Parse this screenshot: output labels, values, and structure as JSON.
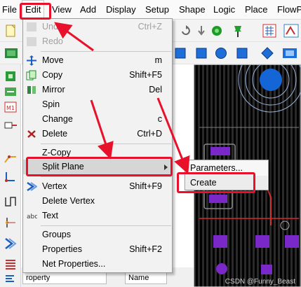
{
  "menubar": {
    "items": [
      "File",
      "Edit",
      "View",
      "Add",
      "Display",
      "Setup",
      "Shape",
      "Logic",
      "Place",
      "FlowPl"
    ]
  },
  "edit_menu": {
    "items": [
      {
        "label": "Undo",
        "shortcut": "Ctrl+Z",
        "enabled": false,
        "icon": "undo-icon"
      },
      {
        "label": "Redo",
        "shortcut": "",
        "enabled": false,
        "icon": "redo-icon"
      },
      {
        "label": "Move",
        "shortcut": "m",
        "enabled": true,
        "icon": "move-icon"
      },
      {
        "label": "Copy",
        "shortcut": "Shift+F5",
        "enabled": true,
        "icon": "copy-icon"
      },
      {
        "label": "Mirror",
        "shortcut": "Del",
        "enabled": true,
        "icon": "mirror-icon"
      },
      {
        "label": "Spin",
        "shortcut": "",
        "enabled": true,
        "icon": ""
      },
      {
        "label": "Change",
        "shortcut": "c",
        "enabled": true,
        "icon": ""
      },
      {
        "label": "Delete",
        "shortcut": "Ctrl+D",
        "enabled": true,
        "icon": "delete-icon"
      },
      {
        "label": "Z-Copy",
        "shortcut": "",
        "enabled": true,
        "icon": ""
      },
      {
        "label": "Split Plane",
        "shortcut": "",
        "enabled": true,
        "icon": "",
        "submenu": true
      },
      {
        "label": "Vertex",
        "shortcut": "Shift+F9",
        "enabled": true,
        "icon": "vertex-icon"
      },
      {
        "label": "Delete Vertex",
        "shortcut": "",
        "enabled": true,
        "icon": ""
      },
      {
        "label": "Text",
        "shortcut": "",
        "enabled": true,
        "icon": "text-icon"
      },
      {
        "label": "Groups",
        "shortcut": "",
        "enabled": true,
        "icon": ""
      },
      {
        "label": "Properties",
        "shortcut": "Shift+F2",
        "enabled": true,
        "icon": ""
      },
      {
        "label": "Net Properties...",
        "shortcut": "",
        "enabled": true,
        "icon": ""
      }
    ]
  },
  "submenu": {
    "items": [
      "Parameters...",
      "Create"
    ]
  },
  "bottom_panel": {
    "col1": "roperty",
    "col2": "Name"
  },
  "watermark": "CSDN @Funny_Beast",
  "colors": {
    "annotation": "#e8102a",
    "pcb_bg": "#000000",
    "pad_purple": "#7a28c8",
    "via_blue": "#1466d6"
  }
}
